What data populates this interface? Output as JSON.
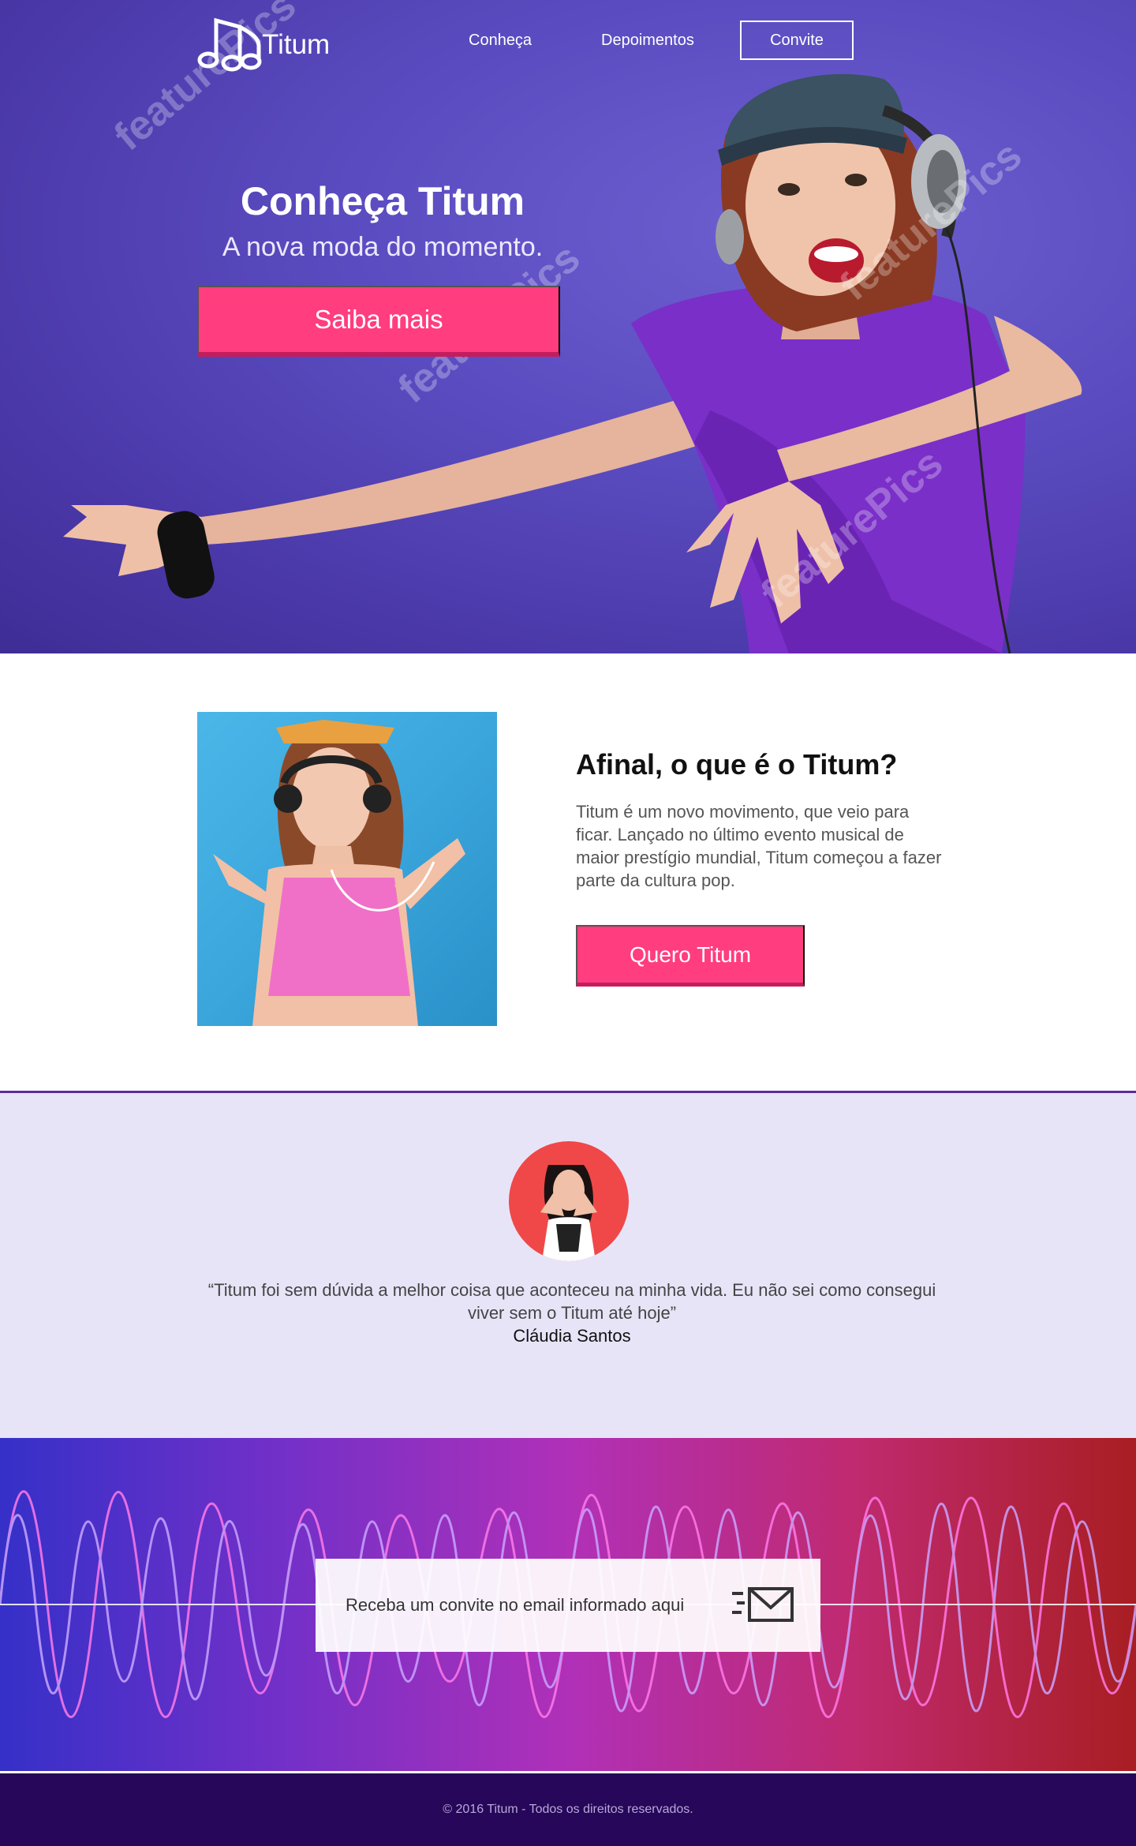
{
  "brand": {
    "name": "Titum",
    "logo_icon": "music-notes-icon"
  },
  "nav": {
    "items": [
      "Conheça",
      "Depoimentos"
    ],
    "cta": "Convite"
  },
  "hero": {
    "title": "Conheça Titum",
    "subtitle": "A nova moda do momento.",
    "button": "Saiba mais"
  },
  "about": {
    "title": "Afinal, o que é o Titum?",
    "text": "Titum é um novo movimento, que veio para ficar. Lançado no último evento musical de maior prestígio mundial, Titum começou a fazer parte da cultura pop.",
    "button": "Quero Titum"
  },
  "testimonial": {
    "quote": "“Titum foi sem dúvida a melhor coisa que aconteceu na minha vida. Eu não sei como consegui viver sem o Titum até hoje”",
    "author": "Cláudia Santos"
  },
  "invite": {
    "text": "Receba um convite no email informado aqui",
    "icon": "envelope-icon"
  },
  "footer": {
    "text": "© 2016 Titum - Todos os direitos reservados."
  },
  "watermark": {
    "text": "featurePics"
  },
  "colors": {
    "hero_bg": "#5a4cc0",
    "accent": "#ff3d7f",
    "testimonial_bg": "#e8e4f8",
    "footer_bg": "#26075a"
  }
}
